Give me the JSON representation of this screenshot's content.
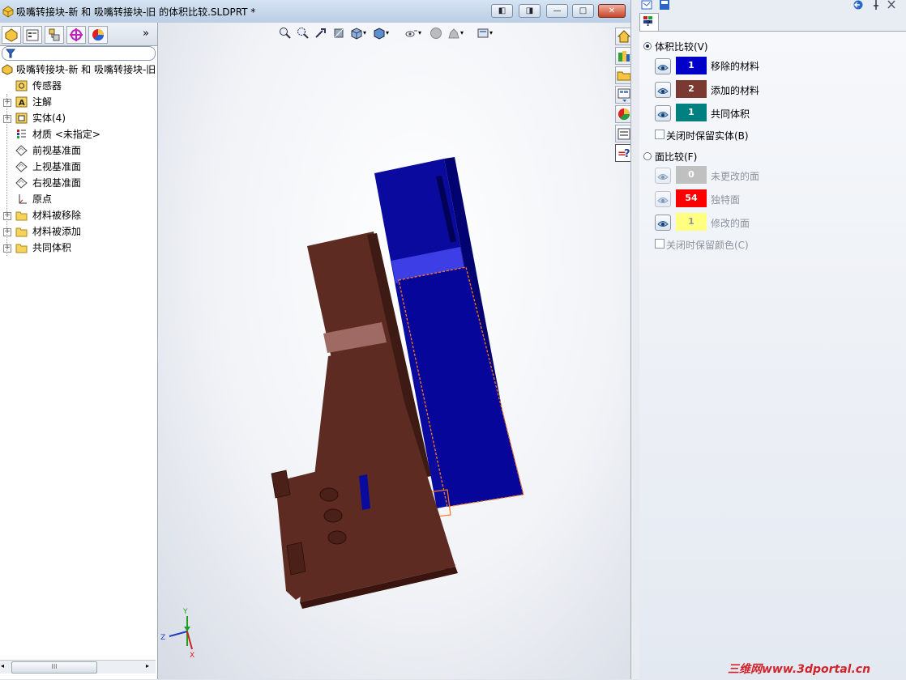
{
  "window": {
    "title": "吸嘴转接块-新 和 吸嘴转接块-旧 的体积比较.SLDPRT *",
    "buttons": [
      "◧",
      "◨",
      "—",
      "□",
      "✕"
    ]
  },
  "feature_manager": {
    "tab_icons": [
      "feature-manager-icon",
      "property-manager-icon",
      "configuration-manager-icon",
      "dimxpert-icon",
      "display-manager-icon"
    ],
    "more_tabs": "»",
    "filter_icon": "filter-icon",
    "root_label": "吸嘴转接块-新 和 吸嘴转接块-旧",
    "items": [
      {
        "label": "传感器",
        "icon": "sensor-icon",
        "expandable": false
      },
      {
        "label": "注解",
        "icon": "annotation-icon",
        "expandable": true
      },
      {
        "label": "实体(4)",
        "icon": "solid-bodies-icon",
        "expandable": true
      },
      {
        "label": "材质 <未指定>",
        "icon": "material-icon",
        "expandable": false
      },
      {
        "label": "前视基准面",
        "icon": "plane-icon",
        "expandable": false
      },
      {
        "label": "上视基准面",
        "icon": "plane-icon",
        "expandable": false
      },
      {
        "label": "右视基准面",
        "icon": "plane-icon",
        "expandable": false
      },
      {
        "label": "原点",
        "icon": "origin-icon",
        "expandable": false
      },
      {
        "label": "材料被移除",
        "icon": "folder-icon",
        "expandable": true
      },
      {
        "label": "材料被添加",
        "icon": "folder-icon",
        "expandable": true
      },
      {
        "label": "共同体积",
        "icon": "folder-icon",
        "expandable": true
      }
    ],
    "scroll_thumb": "III"
  },
  "viewport": {
    "triad": {
      "y": "Y",
      "z": "Z",
      "x": "X"
    }
  },
  "compare_panel": {
    "tab_label": "?",
    "volume_compare": {
      "label": "体积比较(V)",
      "selected": true,
      "rows": [
        {
          "count": "1",
          "label": "移除的材料",
          "color": "#0000c8"
        },
        {
          "count": "2",
          "label": "添加的材料",
          "color": "#7a3a32"
        },
        {
          "count": "1",
          "label": "共同体积",
          "color": "#008080"
        }
      ],
      "keep_bodies": "关闭时保留实体(B)"
    },
    "face_compare": {
      "label": "面比较(F)",
      "selected": false,
      "rows": [
        {
          "count": "0",
          "label": "未更改的面",
          "color": "#c0c0c0"
        },
        {
          "count": "54",
          "label": "独特面",
          "color": "#ff0000"
        },
        {
          "count": "1",
          "label": "修改的面",
          "color": "#ffff80"
        }
      ],
      "keep_colors": "关闭时保留颜色(C)"
    }
  },
  "watermark": "三维网www.3dportal.cn"
}
